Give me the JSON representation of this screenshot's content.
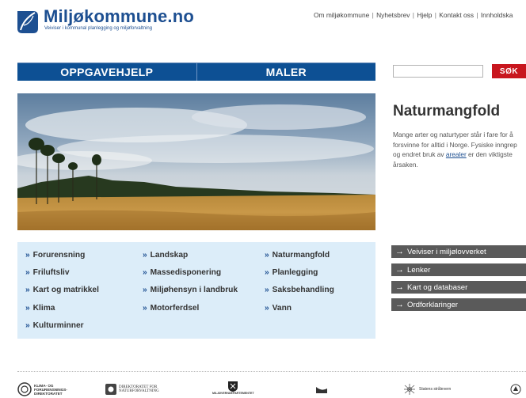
{
  "header": {
    "site_name": "Miljøkommune.no",
    "tagline": "Veiviser i kommunal planlegging og miljøforvaltning",
    "top_links": [
      "Om miljøkommune",
      "Nyhetsbrev",
      "Hjelp",
      "Kontakt oss",
      "Innholdska"
    ]
  },
  "nav": {
    "items": [
      "OPPGAVEHJELP",
      "MALER"
    ]
  },
  "search": {
    "value": "",
    "button_label": "SØK"
  },
  "feature": {
    "title": "Naturmangfold",
    "text_before_link": "Mange arter og naturtyper står i fare for å forsvinne for alltid i Norge. Fysiske inngrep og endret bruk av ",
    "link_text": "arealer",
    "text_after_link": " er den viktigste årsaken."
  },
  "topics": {
    "marker": "»",
    "col1": [
      "Forurensning",
      "Friluftsliv",
      "Kart og matrikkel",
      "Klima",
      "Kulturminner"
    ],
    "col2": [
      "Landskap",
      "Massedisponering",
      "Miljøhensyn i landbruk",
      "Motorferdsel"
    ],
    "col3": [
      "Naturmangfold",
      "Planlegging",
      "Saksbehandling",
      "Vann"
    ]
  },
  "side_links": {
    "arrow": "→",
    "items": [
      "Veiviser i miljølovverket",
      "Lenker",
      "Kart og databaser",
      "Ordforklaringer"
    ]
  },
  "footer": {
    "klif_line1": "KLIMA- OG",
    "klif_line2": "FORURENSNINGS-",
    "klif_line3": "DIREKTORATET",
    "dn_line1": "DIREKTORATET FOR",
    "dn_line2": "NATURFORVALTNING",
    "md_label": "MILJØVERNDEPARTEMENTET",
    "sv_label": "Statens strålevern"
  },
  "colors": {
    "brand_blue": "#1d4f91",
    "nav_blue": "#0d5094",
    "search_red": "#c8161e",
    "topics_bg": "#dcedf9",
    "side_link_bg": "#5a5a5a"
  }
}
